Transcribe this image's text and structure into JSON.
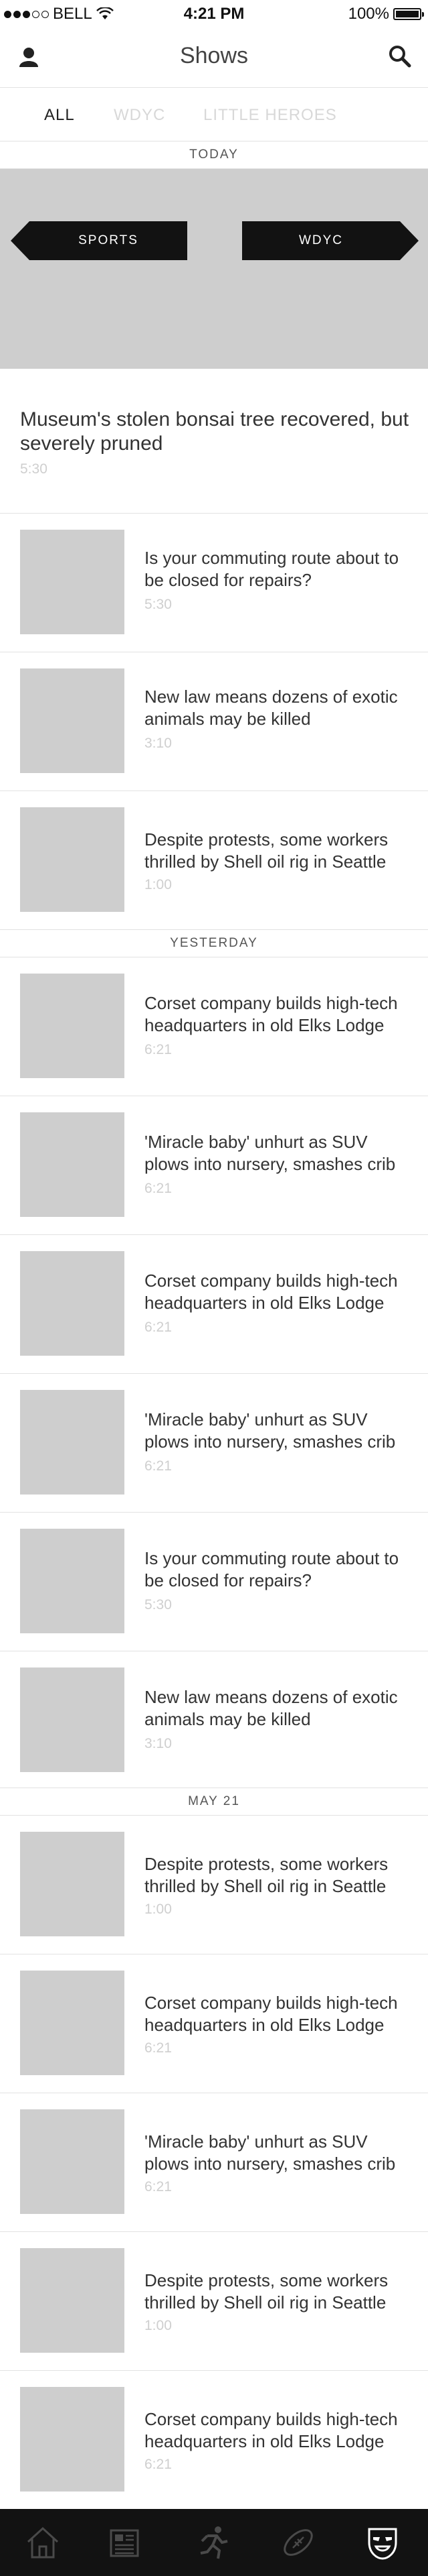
{
  "status_bar": {
    "carrier": "BELL",
    "time": "4:21 PM",
    "battery": "100%"
  },
  "header": {
    "title": "Shows"
  },
  "tabs": [
    {
      "label": "ALL"
    },
    {
      "label": "WDYC"
    },
    {
      "label": "LITTLE HEROES"
    }
  ],
  "sections": {
    "today": "TODAY",
    "yesterday": "YESTERDAY",
    "may21": "MAY 21"
  },
  "hero": {
    "tags": [
      "SPORTS",
      "WDYC"
    ]
  },
  "feature": {
    "title": "Museum's stolen bonsai tree recovered, but severely pruned",
    "time": "5:30"
  },
  "items": [
    {
      "title": "Is your commuting route about to be closed for repairs?",
      "time": "5:30"
    },
    {
      "title": "New law means dozens of exotic animals may be killed",
      "time": "3:10"
    },
    {
      "title": "Despite protests, some workers thrilled by Shell oil rig in Seattle",
      "time": "1:00"
    },
    {
      "title": "Corset company builds high-tech headquarters in old Elks Lodge",
      "time": "6:21"
    },
    {
      "title": "'Miracle baby' unhurt as SUV plows into nursery, smashes crib",
      "time": "6:21"
    },
    {
      "title": "Corset company builds high-tech headquarters in old Elks Lodge",
      "time": "6:21"
    },
    {
      "title": "'Miracle baby' unhurt as SUV plows into nursery, smashes crib",
      "time": "6:21"
    },
    {
      "title": "Is your commuting route about to be closed for repairs?",
      "time": "5:30"
    },
    {
      "title": "New law means dozens of exotic animals may be killed",
      "time": "3:10"
    },
    {
      "title": "Despite protests, some workers thrilled by Shell oil rig in Seattle",
      "time": "1:00"
    },
    {
      "title": "Corset company builds high-tech headquarters in old Elks Lodge",
      "time": "6:21"
    },
    {
      "title": "'Miracle baby' unhurt as SUV plows into nursery, smashes crib",
      "time": "6:21"
    },
    {
      "title": "Despite protests, some workers thrilled by Shell oil rig in Seattle",
      "time": "1:00"
    },
    {
      "title": "Corset company builds high-tech headquarters in old Elks Lodge",
      "time": "6:21"
    }
  ],
  "tab_bar": {
    "items": [
      {
        "icon": "home-icon"
      },
      {
        "icon": "news-icon"
      },
      {
        "icon": "runner-icon"
      },
      {
        "icon": "football-icon"
      },
      {
        "icon": "mask-icon",
        "active": true
      }
    ]
  }
}
